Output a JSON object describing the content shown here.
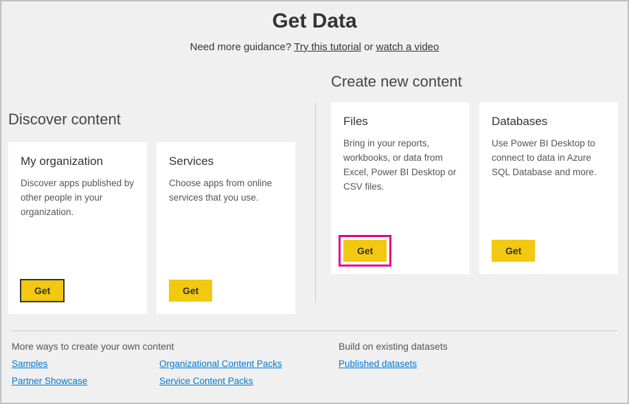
{
  "header": {
    "title": "Get Data",
    "guidance_prefix": "Need more guidance? ",
    "tutorial_link": "Try this tutorial",
    "guidance_or": " or ",
    "video_link": "watch a video"
  },
  "discover": {
    "title": "Discover content",
    "cards": [
      {
        "title": "My organization",
        "desc": "Discover apps published by other people in your organization.",
        "button": "Get"
      },
      {
        "title": "Services",
        "desc": "Choose apps from online services that you use.",
        "button": "Get"
      }
    ]
  },
  "create": {
    "title": "Create new content",
    "cards": [
      {
        "title": "Files",
        "desc": "Bring in your reports, workbooks, or data from Excel, Power BI Desktop or CSV files.",
        "button": "Get"
      },
      {
        "title": "Databases",
        "desc": "Use Power BI Desktop to connect to data in Azure SQL Database and more.",
        "button": "Get"
      }
    ]
  },
  "bottom": {
    "left_title": "More ways to create your own content",
    "right_title": "Build on existing datasets",
    "links": {
      "col1": [
        "Samples",
        "Partner Showcase"
      ],
      "col2": [
        "Organizational Content Packs",
        "Service Content Packs"
      ],
      "col3": [
        "Published datasets"
      ]
    }
  }
}
